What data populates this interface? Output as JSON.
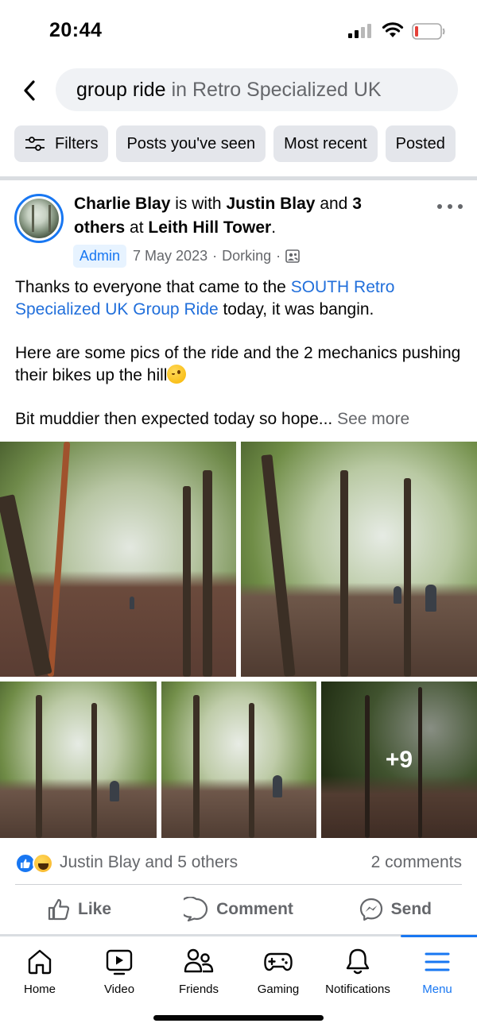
{
  "status_bar": {
    "time": "20:44"
  },
  "search": {
    "query": "group ride",
    "scope": "in Retro Specialized UK"
  },
  "filters": [
    {
      "label": "Filters",
      "icon": "sliders-icon"
    },
    {
      "label": "Posts you've seen"
    },
    {
      "label": "Most recent"
    },
    {
      "label": "Posted"
    }
  ],
  "post": {
    "author": "Charlie Blay",
    "with_text": "is with",
    "tagged": "Justin Blay",
    "and_text": "and",
    "others": "3 others",
    "at_text": "at",
    "location": "Leith Hill Tower",
    "badge": "Admin",
    "date": "7 May 2023",
    "place": "Dorking",
    "privacy_icon": "group-audience-icon",
    "text": {
      "p1_before": "Thanks to everyone that came to the ",
      "p1_link": "SOUTH Retro Specialized UK Group Ride",
      "p1_after": " today, it was bangin.",
      "p2": "Here are some pics of the ride and the 2 mechanics pushing their bikes up the hill",
      "p3": "Bit muddier then expected today so hope...",
      "see_more": "See more"
    },
    "photos_more": "+9",
    "reactions": {
      "summary": "Justin Blay and 5 others",
      "comments": "2 comments",
      "types": [
        "like",
        "haha"
      ]
    },
    "actions": {
      "like": "Like",
      "comment": "Comment",
      "send": "Send"
    }
  },
  "tabs": [
    {
      "label": "Home",
      "icon": "home-icon"
    },
    {
      "label": "Video",
      "icon": "video-icon"
    },
    {
      "label": "Friends",
      "icon": "friends-icon"
    },
    {
      "label": "Gaming",
      "icon": "gaming-icon"
    },
    {
      "label": "Notifications",
      "icon": "bell-icon"
    },
    {
      "label": "Menu",
      "icon": "menu-icon",
      "active": true
    }
  ],
  "colors": {
    "accent": "#1877f2",
    "link": "#216fdb",
    "muted": "#65676b",
    "chip_bg": "#e4e6eb",
    "search_bg": "#f0f2f5"
  }
}
